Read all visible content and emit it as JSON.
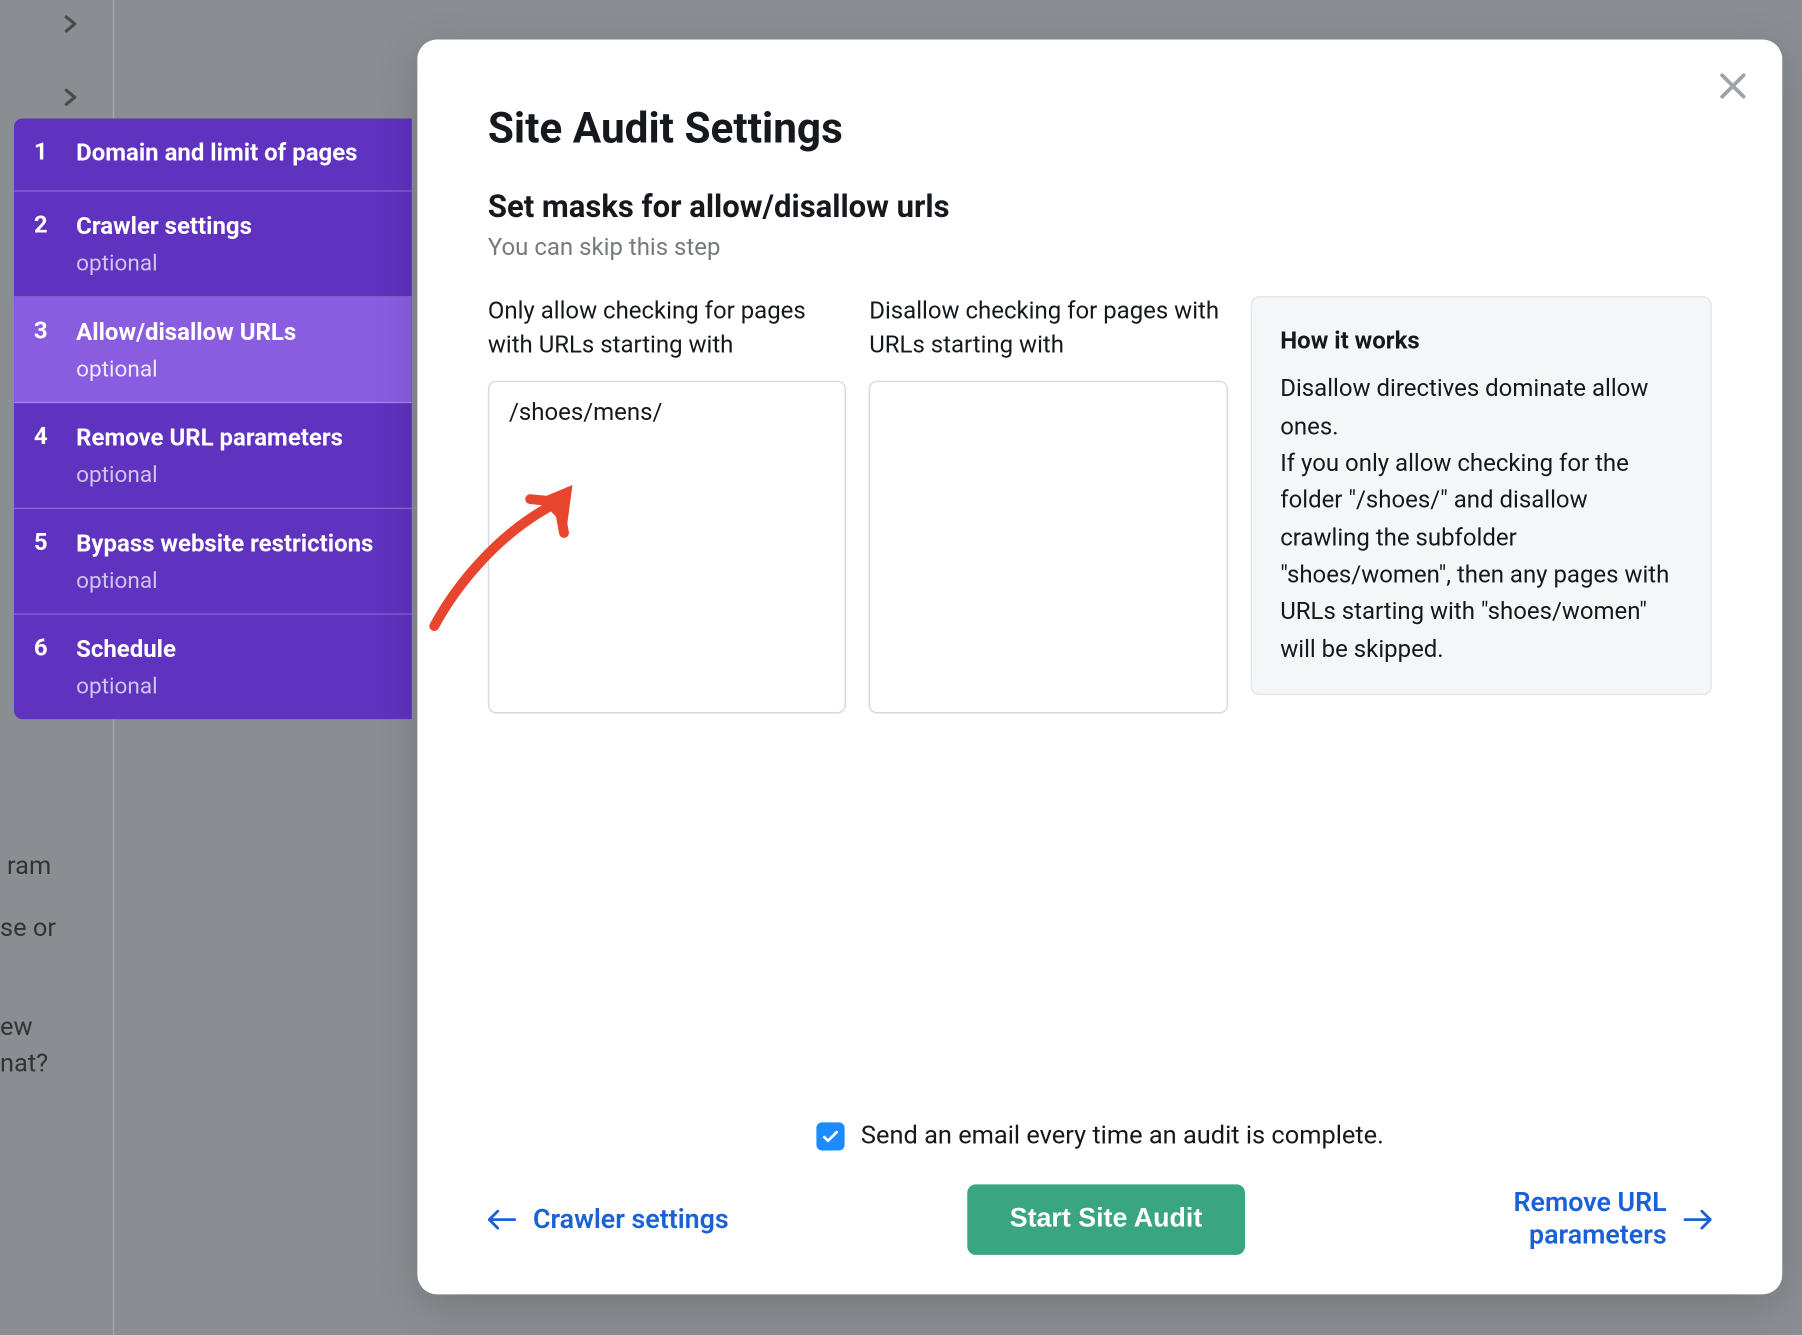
{
  "steps": [
    {
      "number": "1",
      "label": "Domain and limit of pages",
      "optional": ""
    },
    {
      "number": "2",
      "label": "Crawler settings",
      "optional": "optional"
    },
    {
      "number": "3",
      "label": "Allow/disallow URLs",
      "optional": "optional"
    },
    {
      "number": "4",
      "label": "Remove URL parameters",
      "optional": "optional"
    },
    {
      "number": "5",
      "label": "Bypass website restrictions",
      "optional": "optional"
    },
    {
      "number": "6",
      "label": "Schedule",
      "optional": "optional"
    }
  ],
  "modal": {
    "title": "Site Audit Settings",
    "subtitle": "Set masks for allow/disallow urls",
    "hint": "You can skip this step",
    "allow_label": "Only allow checking for pages with URLs starting with",
    "disallow_label": "Disallow checking for pages with URLs starting with",
    "allow_value": "/shoes/mens/",
    "disallow_value": "",
    "info_title": "How it works",
    "info_body": "Disallow directives dominate allow ones.\nIf you only allow checking for the folder \"/shoes/\" and disallow crawling the subfolder \"shoes/women\", then any pages with URLs starting with \"shoes/women\" will be skipped."
  },
  "footer": {
    "email_label": "Send an email every time an audit is complete.",
    "prev_label": "Crawler settings",
    "start_label": "Start Site Audit",
    "next_label": "Remove URL parameters"
  },
  "bg": {
    "frag1": "ram",
    "frag2": "se or",
    "frag3": "ew",
    "frag4": "nat?"
  }
}
